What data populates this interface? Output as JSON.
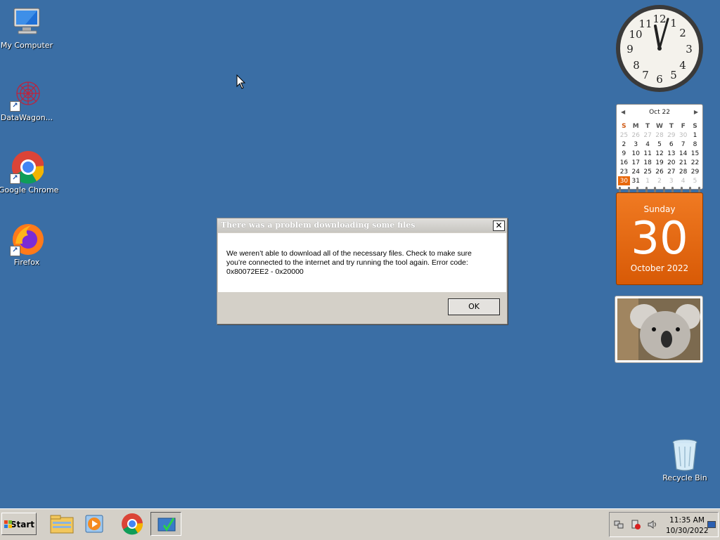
{
  "desktop": {
    "icons": [
      {
        "label": "My Computer"
      },
      {
        "label": "DataWagon..."
      },
      {
        "label": "Google Chrome"
      },
      {
        "label": "Firefox"
      },
      {
        "label": "Recycle Bin"
      }
    ]
  },
  "clock": {
    "numbers": [
      "12",
      "1",
      "2",
      "3",
      "4",
      "5",
      "6",
      "7",
      "8",
      "9",
      "10",
      "11"
    ],
    "time": "11:35"
  },
  "calendar": {
    "month_label": "Oct 22",
    "weekdays": [
      "S",
      "M",
      "T",
      "W",
      "T",
      "F",
      "S"
    ],
    "weeks": [
      [
        "25",
        "26",
        "27",
        "28",
        "29",
        "30",
        "1"
      ],
      [
        "2",
        "3",
        "4",
        "5",
        "6",
        "7",
        "8"
      ],
      [
        "9",
        "10",
        "11",
        "12",
        "13",
        "14",
        "15"
      ],
      [
        "16",
        "17",
        "18",
        "19",
        "20",
        "21",
        "22"
      ],
      [
        "23",
        "24",
        "25",
        "26",
        "27",
        "28",
        "29"
      ],
      [
        "30",
        "31",
        "1",
        "2",
        "3",
        "4",
        "5"
      ]
    ],
    "day_name": "Sunday",
    "day_number": "30",
    "month_year": "October 2022"
  },
  "dialog": {
    "title": "There was a problem downloading some files",
    "close_label": "✕",
    "message": "We weren’t able to download all of the necessary files. Check to make sure you’re connected to the internet and try running the tool again. Error code: 0x80072EE2 - 0x20000",
    "ok_label": "OK"
  },
  "taskbar": {
    "start_label": "Start",
    "buttons": [
      {
        "icon": "file-explorer-icon"
      },
      {
        "icon": "media-player-icon"
      },
      {
        "icon": "chrome-icon"
      },
      {
        "icon": "media-creation-tool-icon"
      }
    ],
    "tray": {
      "time": "11:35 AM",
      "date": "10/30/2022"
    }
  },
  "colors": {
    "desktop": "#3a6ea5",
    "calendar_accent": "#e8680c"
  }
}
